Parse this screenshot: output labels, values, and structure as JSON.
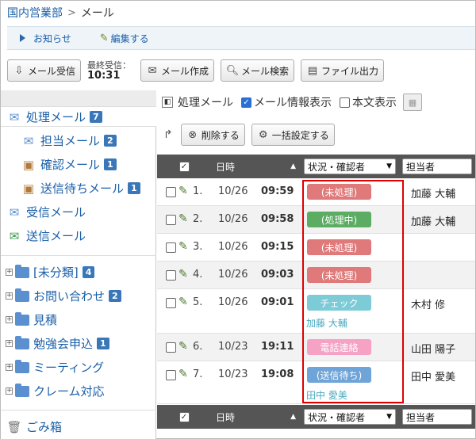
{
  "breadcrumb": {
    "root": "国内営業部",
    "current": "メール"
  },
  "topbar": {
    "notice": "お知らせ",
    "edit": "編集する"
  },
  "toolbar": {
    "receive": "メール受信",
    "last_label": "最終受信：",
    "last_time": "10:31",
    "compose": "メール作成",
    "search": "メール検索",
    "export": "ファイル出力"
  },
  "sidebar": {
    "processing": {
      "label": "処理メール",
      "count": "7"
    },
    "assigned": {
      "label": "担当メール",
      "count": "2"
    },
    "confirm": {
      "label": "確認メール",
      "count": "1"
    },
    "waiting": {
      "label": "送信待ちメール",
      "count": "1"
    },
    "inbox": "受信メール",
    "sent": "送信メール",
    "folders": [
      {
        "label": "[未分類]",
        "count": "4"
      },
      {
        "label": "お問い合わせ",
        "count": "2"
      },
      {
        "label": "見積",
        "count": ""
      },
      {
        "label": "勉強会申込",
        "count": "1"
      },
      {
        "label": "ミーティング",
        "count": ""
      },
      {
        "label": "クレーム対応",
        "count": ""
      }
    ],
    "trash": "ごみ箱"
  },
  "main": {
    "title": "処理メール",
    "show_info": "メール情報表示",
    "show_body": "本文表示",
    "delete": "削除する",
    "bulk": "一括設定する",
    "col_date": "日時",
    "col_status": "状況・確認者",
    "col_assignee": "担当者"
  },
  "colors": {
    "unprocessed": "#e07a7a",
    "processing": "#5cac64",
    "check": "#7ecbd8",
    "phone": "#f5a2c4",
    "waiting": "#6ea4d8"
  },
  "rows": [
    {
      "num": "1.",
      "date": "10/26",
      "time": "09:59",
      "status": "(未処理)",
      "checker": "",
      "assignee": "加藤 大輔"
    },
    {
      "num": "2.",
      "date": "10/26",
      "time": "09:58",
      "status": "(処理中)",
      "checker": "",
      "assignee": "加藤 大輔"
    },
    {
      "num": "3.",
      "date": "10/26",
      "time": "09:15",
      "status": "(未処理)",
      "checker": "",
      "assignee": ""
    },
    {
      "num": "4.",
      "date": "10/26",
      "time": "09:03",
      "status": "(未処理)",
      "checker": "",
      "assignee": ""
    },
    {
      "num": "5.",
      "date": "10/26",
      "time": "09:01",
      "status": "チェック",
      "checker": "加藤 大輔",
      "assignee": "木村 修"
    },
    {
      "num": "6.",
      "date": "10/23",
      "time": "19:11",
      "status": "電話連絡",
      "checker": "",
      "assignee": "山田 陽子"
    },
    {
      "num": "7.",
      "date": "10/23",
      "time": "19:08",
      "status": "(送信待ち)",
      "checker": "田中 愛美",
      "assignee": "田中 愛美"
    }
  ]
}
